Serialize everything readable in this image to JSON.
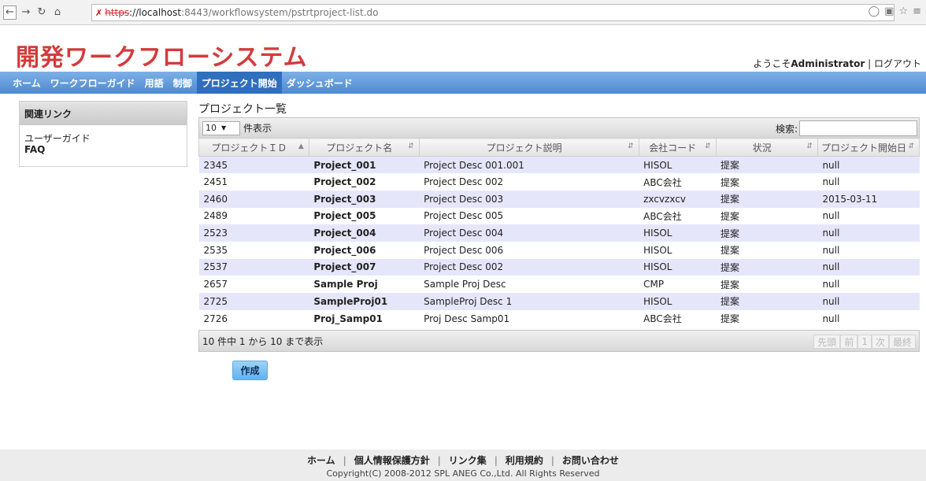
{
  "browser": {
    "url_protocol": "https",
    "url_host": "://localhost",
    "url_path": ":8443/workflowsystem/pstrtproject-list.do"
  },
  "header": {
    "app_title": "開発ワークフローシステム",
    "welcome_prefix": "ようこそ",
    "user": "Administrator",
    "logout": "ログアウト"
  },
  "nav": [
    "ホーム",
    "ワークフローガイド",
    "用語",
    "制御",
    "プロジェクト開始",
    "ダッシュボード"
  ],
  "sidebar": {
    "title": "関連リンク",
    "links": [
      "ユーザーガイド",
      "FAQ"
    ]
  },
  "main": {
    "title": "プロジェクト一覧",
    "page_length": "10",
    "length_label": "件表示",
    "search_label": "検索:",
    "columns": [
      "プロジェクトＩＤ",
      "プロジェクト名",
      "プロジェクト説明",
      "会社コード",
      "状況",
      "プロジェクト開始日"
    ],
    "rows": [
      [
        "2345",
        "Project_001",
        "Project Desc 001.001",
        "HISOL",
        "提案",
        "null"
      ],
      [
        "2451",
        "Project_002",
        "Project Desc 002",
        "ABC会社",
        "提案",
        "null"
      ],
      [
        "2460",
        "Project_003",
        "Project Desc 003",
        "zxcvzxcv",
        "提案",
        "2015-03-11"
      ],
      [
        "2489",
        "Project_005",
        "Project Desc 005",
        "ABC会社",
        "提案",
        "null"
      ],
      [
        "2523",
        "Project_004",
        "Project Desc 004",
        "HISOL",
        "提案",
        "null"
      ],
      [
        "2535",
        "Project_006",
        "Project Desc 006",
        "HISOL",
        "提案",
        "null"
      ],
      [
        "2537",
        "Project_007",
        "Project Desc 002",
        "HISOL",
        "提案",
        "null"
      ],
      [
        "2657",
        "Sample Proj",
        "Sample Proj Desc",
        "CMP",
        "提案",
        "null"
      ],
      [
        "2725",
        "SampleProj01",
        "SampleProj Desc 1",
        "HISOL",
        "提案",
        "null"
      ],
      [
        "2726",
        "Proj_Samp01",
        "Proj Desc Samp01",
        "ABC会社",
        "提案",
        "null"
      ]
    ],
    "info": "10 件中 1 から 10 まで表示",
    "pager": [
      "先頭",
      "前",
      "1",
      "次",
      "最終"
    ],
    "create_button": "作成"
  },
  "footer": {
    "links": [
      "ホーム",
      "個人情報保護方針",
      "リンク集",
      "利用規約",
      "お問い合わせ"
    ],
    "copyright": "Copyright(C) 2008-2012 SPL ANEG Co.,Ltd. All Rights Reserved"
  }
}
